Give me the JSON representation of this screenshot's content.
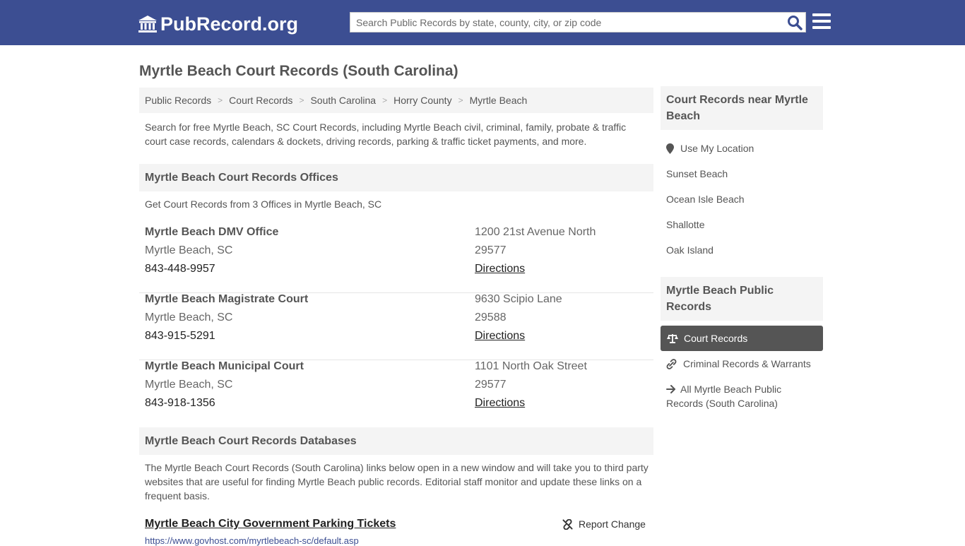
{
  "header": {
    "logo_text": "PubRecord.org",
    "search_placeholder": "Search Public Records by state, county, city, or zip code",
    "brand_color": "#3c4e92"
  },
  "page": {
    "title": "Myrtle Beach Court Records (South Carolina)",
    "breadcrumbs": [
      "Public Records",
      "Court Records",
      "South Carolina",
      "Horry County",
      "Myrtle Beach"
    ],
    "intro": "Search for free Myrtle Beach, SC Court Records, including Myrtle Beach civil, criminal, family, probate & traffic court case records, calendars & dockets, driving records, parking & traffic ticket payments, and more."
  },
  "offices": {
    "heading": "Myrtle Beach Court Records Offices",
    "subheading": "Get Court Records from 3 Offices in Myrtle Beach, SC",
    "items": [
      {
        "name": "Myrtle Beach DMV Office",
        "city": "Myrtle Beach, SC",
        "phone": "843-448-9957",
        "address": "1200 21st Avenue North",
        "zip": "29577",
        "directions": "Directions"
      },
      {
        "name": "Myrtle Beach Magistrate Court",
        "city": "Myrtle Beach, SC",
        "phone": "843-915-5291",
        "address": "9630 Scipio Lane",
        "zip": "29588",
        "directions": "Directions"
      },
      {
        "name": "Myrtle Beach Municipal Court",
        "city": "Myrtle Beach, SC",
        "phone": "843-918-1356",
        "address": "1101 North Oak Street",
        "zip": "29577",
        "directions": "Directions"
      }
    ]
  },
  "databases": {
    "heading": "Myrtle Beach Court Records Databases",
    "intro": "The Myrtle Beach Court Records (South Carolina) links below open in a new window and will take you to third party websites that are useful for finding Myrtle Beach public records. Editorial staff monitor and update these links on a frequent basis.",
    "first_link": "Myrtle Beach City Government Parking Tickets",
    "first_url": "https://www.govhost.com/myrtlebeach-sc/default.asp",
    "report_label": "Report Change"
  },
  "sidebar": {
    "nearby_heading": "Court Records near Myrtle Beach",
    "use_location": "Use My Location",
    "nearby": [
      "Sunset Beach",
      "Ocean Isle Beach",
      "Shallotte",
      "Oak Island"
    ],
    "public_heading": "Myrtle Beach Public Records",
    "active_item": "Court Records",
    "criminal_item": "Criminal Records & Warrants",
    "all_item": "All Myrtle Beach Public Records (South Carolina)"
  }
}
